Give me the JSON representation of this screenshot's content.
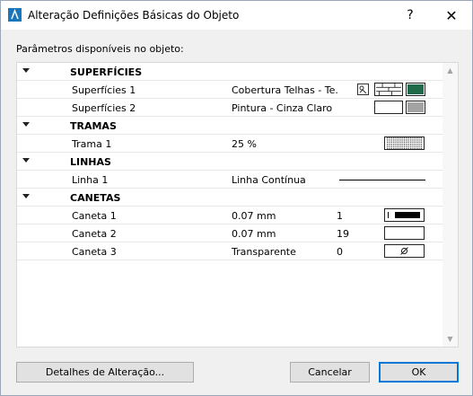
{
  "window": {
    "title": "Alteração Definições Básicas do Objeto",
    "help_label": "?",
    "close_label": "✕"
  },
  "params_label": "Parâmetros disponíveis no objeto:",
  "groups": {
    "superficies": {
      "title": "SUPERFÍCIES",
      "items": [
        {
          "name": "Superfícies 1",
          "value": "Cobertura Telhas - Te..."
        },
        {
          "name": "Superfícies 2",
          "value": "Pintura - Cinza Claro"
        }
      ]
    },
    "tramas": {
      "title": "TRAMAS",
      "items": [
        {
          "name": "Trama 1",
          "value": "25 %"
        }
      ]
    },
    "linhas": {
      "title": "LINHAS",
      "items": [
        {
          "name": "Linha 1",
          "value": "Linha Contínua"
        }
      ]
    },
    "canetas": {
      "title": "CANETAS",
      "items": [
        {
          "name": "Caneta 1",
          "value": "0.07 mm",
          "number": "1"
        },
        {
          "name": "Caneta 2",
          "value": "0.07 mm",
          "number": "19"
        },
        {
          "name": "Caneta 3",
          "value": "Transparente",
          "number": "0"
        }
      ]
    }
  },
  "colors": {
    "surface1_swatch": "#1f6b49",
    "surface2_swatch": "#a3a3a3"
  },
  "buttons": {
    "details": "Detalhes de Alteração...",
    "cancel": "Cancelar",
    "ok": "OK"
  }
}
